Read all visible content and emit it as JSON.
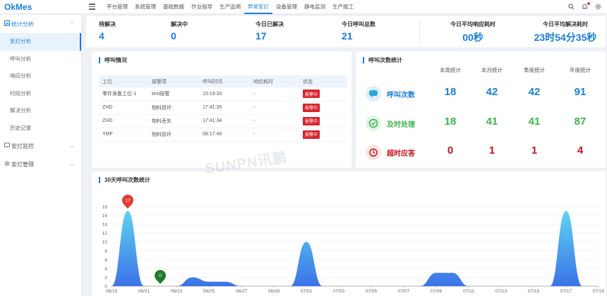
{
  "app": {
    "logo": "OkMes"
  },
  "nav": [
    {
      "label": "平台管理",
      "active": false
    },
    {
      "label": "系统管理",
      "active": false
    },
    {
      "label": "基础数据",
      "active": false
    },
    {
      "label": "作业指导",
      "active": false
    },
    {
      "label": "生产追溯",
      "active": false
    },
    {
      "label": "异常安灯",
      "active": true
    },
    {
      "label": "设备管理",
      "active": false
    },
    {
      "label": "静电监测",
      "active": false
    },
    {
      "label": "生产报工",
      "active": false
    }
  ],
  "top_icons": [
    "search-icon",
    "bell-icon",
    "settings-icon"
  ],
  "sidebar": {
    "groups": [
      {
        "label": "统计分析",
        "icon": "chart-icon",
        "open": true,
        "items": [
          {
            "label": "安灯分析",
            "active": true
          },
          {
            "label": "呼叫分析",
            "active": false
          },
          {
            "label": "响应分析",
            "active": false
          },
          {
            "label": "时段分析",
            "active": false
          },
          {
            "label": "解决分析",
            "active": false
          },
          {
            "label": "历史记录",
            "active": false
          }
        ]
      },
      {
        "label": "安灯监控",
        "icon": "monitor-icon",
        "open": false,
        "items": []
      },
      {
        "label": "安灯管理",
        "icon": "gear-icon",
        "open": false,
        "items": []
      }
    ]
  },
  "stats": [
    {
      "label": "待解决",
      "value": "4"
    },
    {
      "label": "解决中",
      "value": "0"
    },
    {
      "label": "今日已解决",
      "value": "17"
    },
    {
      "label": "今日呼叫总数",
      "value": "21"
    },
    {
      "label": "今日平均响应耗时",
      "value": "00秒"
    },
    {
      "label": "今日平均解决耗时",
      "value": "23时54分35秒"
    }
  ],
  "call_panel": {
    "title": "呼叫情况",
    "columns": [
      "工位",
      "报警项",
      "呼叫时间",
      "响应耗时",
      "状态"
    ],
    "rows": [
      {
        "station": "零件准备工位-1",
        "item": "test报警",
        "time": "15:19:33",
        "resp": "-",
        "status": "报警中"
      },
      {
        "station": "ZHD",
        "item": "物料损坏",
        "time": "17:41:35",
        "resp": "-",
        "status": "报警中"
      },
      {
        "station": "ZHD",
        "item": "物料丢失",
        "time": "17:41:34",
        "resp": "-",
        "status": "报警中"
      },
      {
        "station": "YMF",
        "item": "物料损坏",
        "time": "09:17:40",
        "resp": "-",
        "status": "报警中"
      }
    ]
  },
  "stats_panel": {
    "title": "呼叫次数统计",
    "columns": [
      "本周统计",
      "本月统计",
      "季度统计",
      "年度统计"
    ],
    "rows": [
      {
        "name": "呼叫次数",
        "icon": "chat-icon",
        "color": "#1a7fd6",
        "values": [
          "18",
          "42",
          "42",
          "91"
        ]
      },
      {
        "name": "及时处理",
        "icon": "clock-check-icon",
        "color": "#3bb54a",
        "values": [
          "18",
          "41",
          "41",
          "87"
        ]
      },
      {
        "name": "超时应答",
        "icon": "alarm-icon",
        "color": "#c0171d",
        "values": [
          "0",
          "1",
          "1",
          "4"
        ]
      }
    ]
  },
  "watermark": "SUNPN讯鹏",
  "chart_data": {
    "type": "area",
    "title": "30天呼叫次数统计",
    "x": [
      "06/19",
      "06/20",
      "06/21",
      "06/22",
      "06/23",
      "06/24",
      "06/25",
      "06/26",
      "06/27",
      "06/28",
      "06/29",
      "06/30",
      "07/01",
      "07/02",
      "07/03",
      "07/04",
      "07/05",
      "07/06",
      "07/07",
      "07/08",
      "07/09",
      "07/10",
      "07/11",
      "07/12",
      "07/13",
      "07/14",
      "07/15",
      "07/16",
      "07/17",
      "07/18",
      "07/19"
    ],
    "x_tick_labels": [
      "06/19",
      "06/21",
      "06/23",
      "06/25",
      "06/27",
      "06/29",
      "07/01",
      "07/03",
      "07/05",
      "07/07",
      "07/09",
      "07/11",
      "07/13",
      "07/15",
      "07/17",
      "07/19"
    ],
    "series": [
      {
        "values": [
          0,
          17,
          0,
          0,
          0,
          2,
          1,
          1,
          0,
          0,
          0,
          0,
          10,
          0,
          0,
          0,
          0,
          0,
          0,
          0,
          3,
          3,
          0,
          0,
          0,
          0,
          0,
          0,
          17,
          0,
          0
        ]
      }
    ],
    "ylim": [
      0,
      18
    ],
    "yticks": [
      0,
      2,
      4,
      6,
      8,
      10,
      12,
      14,
      16,
      18
    ],
    "grid": true,
    "markers": [
      {
        "index": 1,
        "label": "17",
        "kind": "max",
        "color": "#e53935"
      },
      {
        "index": 3,
        "label": "0",
        "kind": "min",
        "color": "#1e7d2b"
      }
    ]
  }
}
